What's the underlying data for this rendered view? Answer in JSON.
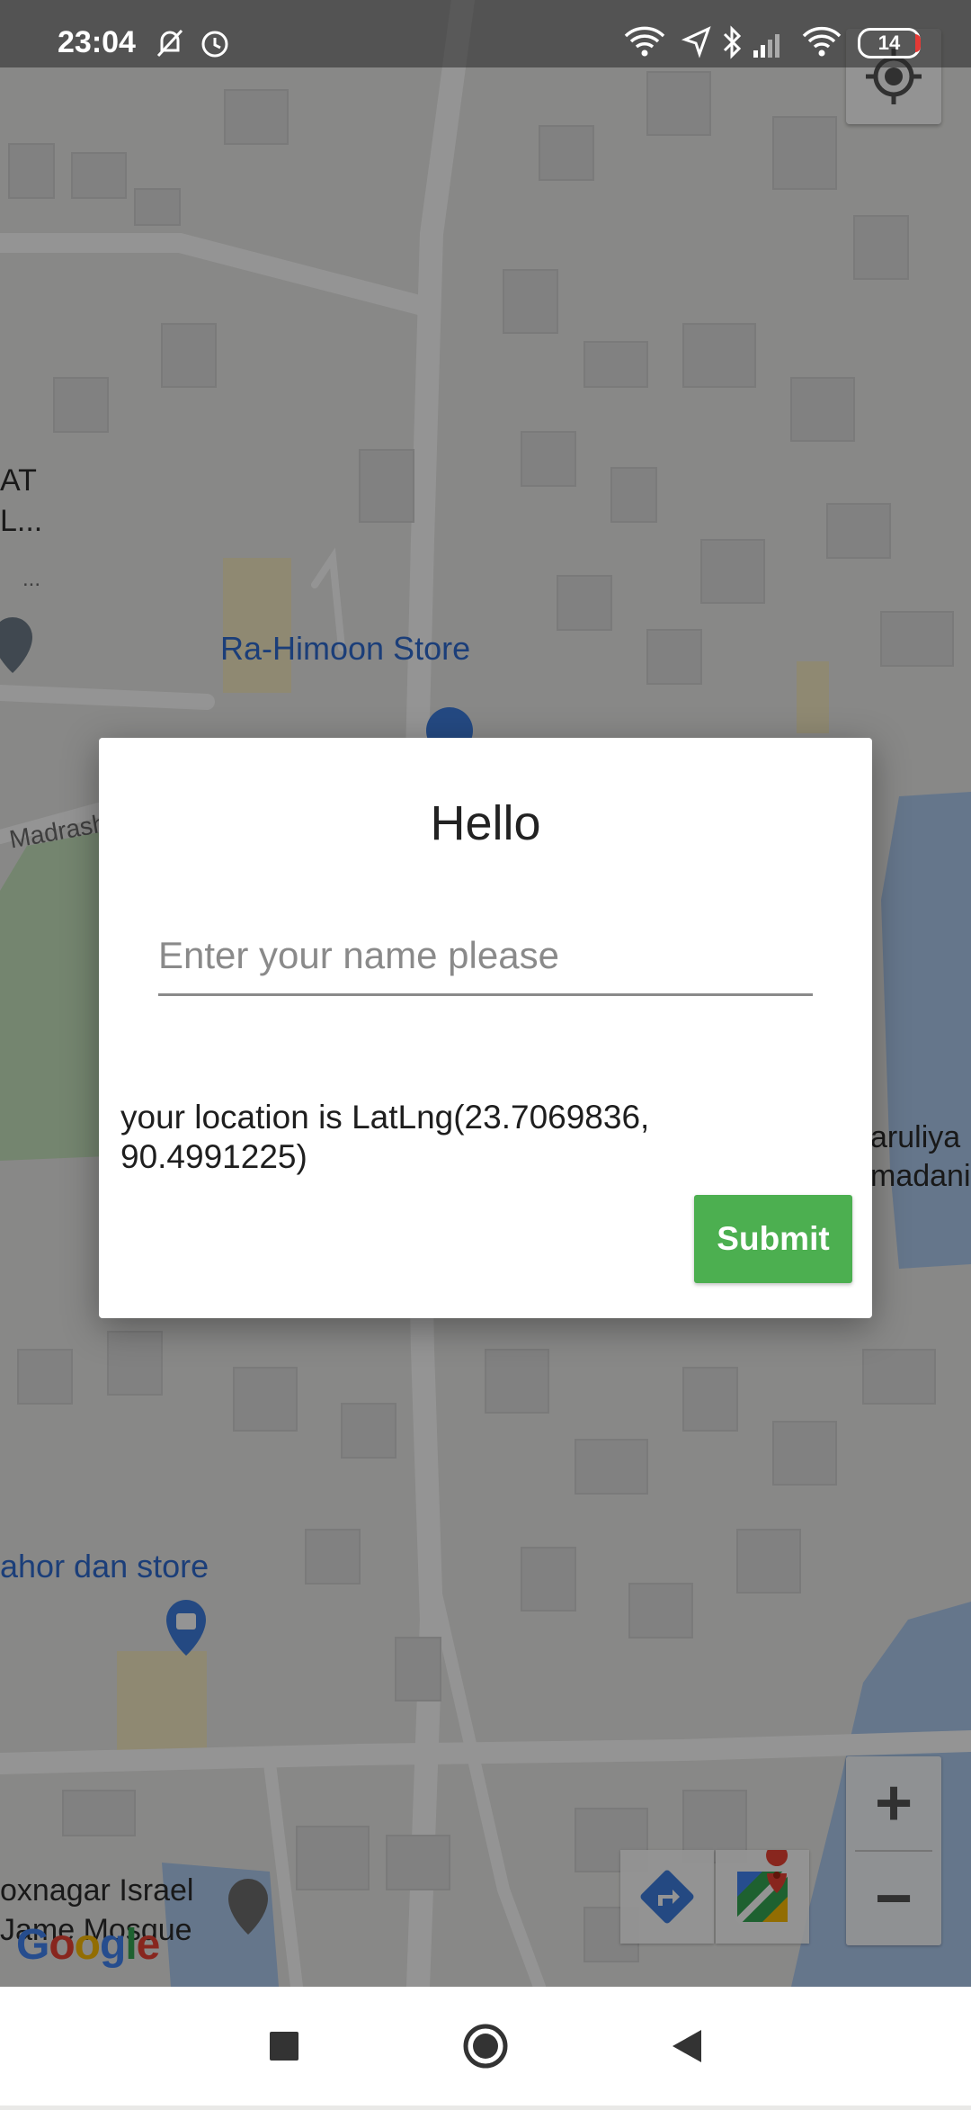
{
  "status_bar": {
    "time": "23:04",
    "battery_level": "14"
  },
  "map": {
    "pois": {
      "ra_himoon_store": "Ra-Himoon Store",
      "ahor_dan_store": "ahor dan store",
      "mosque_line1": "oxnagar Israel",
      "mosque_line2": "Jame Mosque",
      "left_label_line1": "AT",
      "left_label_line2": "L...",
      "left_label_line3": "...",
      "madrasha_label": "Madrash",
      "right_label_line1": "aruliya",
      "right_label_line2": "madani"
    },
    "attribution": "Google",
    "zoom_in_label": "+",
    "zoom_out_label": "−"
  },
  "dialog": {
    "title": "Hello",
    "name_placeholder": "Enter your name please",
    "location_text": "your location is LatLng(23.7069836, 90.4991225)",
    "submit_label": "Submit"
  }
}
